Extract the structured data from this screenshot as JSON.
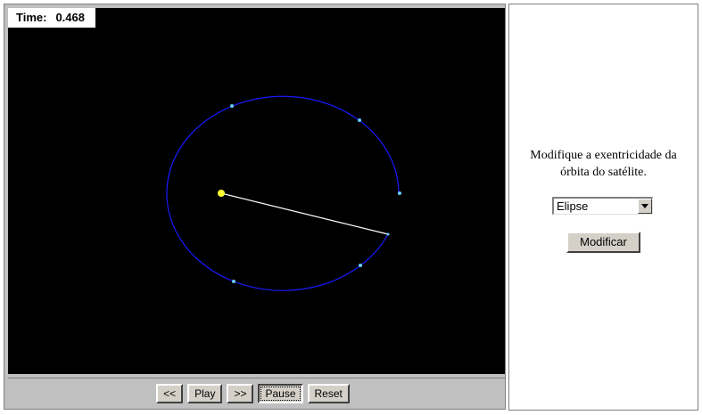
{
  "simulation": {
    "time_label": "Time:",
    "time_value": "0.468",
    "colors": {
      "background": "#000000",
      "orbit": "#1a1aff",
      "radius_line": "#ffffff",
      "star": "#ffff33",
      "marker": "#66ccff"
    }
  },
  "controls": {
    "rewind_label": "<<",
    "play_label": "Play",
    "forward_label": ">>",
    "pause_label": "Pause",
    "reset_label": "Reset"
  },
  "side_panel": {
    "instruction_line1": "Modifique a exentricidade da",
    "instruction_line2": "órbita do satélite.",
    "eccentricity_select": {
      "selected": "Elipse"
    },
    "modify_label": "Modificar"
  }
}
